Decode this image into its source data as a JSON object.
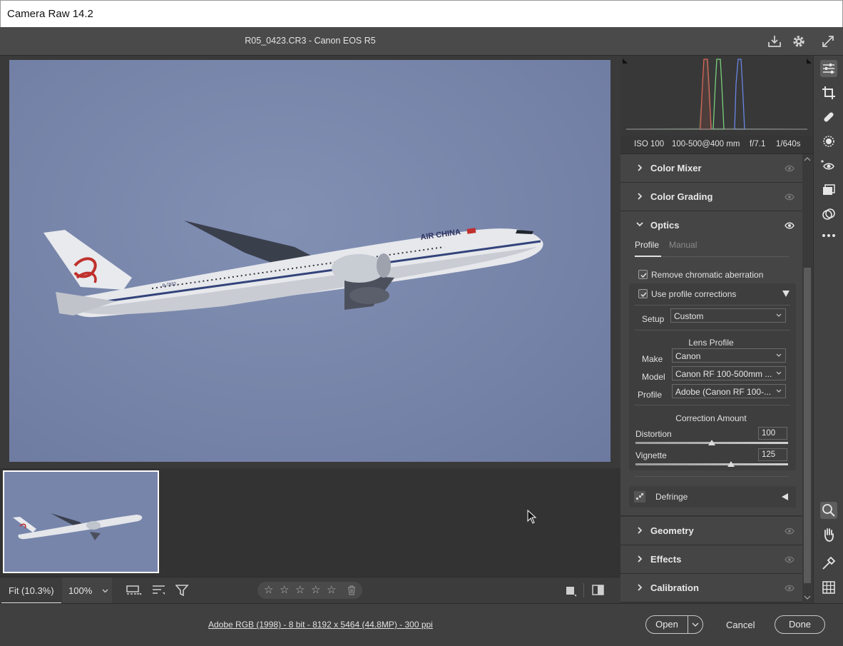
{
  "window": {
    "title": "Camera Raw 14.2"
  },
  "file": {
    "title": "R05_0423.CR3  -  Canon EOS R5"
  },
  "photo": {
    "airline_text": "AIR CHINA",
    "registration": "B-7832"
  },
  "exif": {
    "iso": "ISO 100",
    "lens": "100-500@400 mm",
    "aperture": "f/7.1",
    "shutter": "1/640s"
  },
  "panels": {
    "color_mixer": "Color Mixer",
    "color_grading": "Color Grading",
    "optics": "Optics",
    "geometry": "Geometry",
    "effects": "Effects",
    "calibration": "Calibration"
  },
  "optics": {
    "tabs": {
      "profile": "Profile",
      "manual": "Manual"
    },
    "remove_ca": {
      "label": "Remove chromatic aberration",
      "checked": true
    },
    "use_profile": {
      "label": "Use profile corrections",
      "checked": true
    },
    "setup": {
      "label": "Setup",
      "value": "Custom"
    },
    "lens_profile_heading": "Lens Profile",
    "make": {
      "label": "Make",
      "value": "Canon"
    },
    "model": {
      "label": "Model",
      "value": "Canon RF 100-500mm ..."
    },
    "profile": {
      "label": "Profile",
      "value": "Adobe (Canon RF 100-..."
    },
    "correction_heading": "Correction Amount",
    "distortion": {
      "label": "Distortion",
      "value": "100",
      "level": 0.5
    },
    "vignette": {
      "label": "Vignette",
      "value": "125",
      "level": 0.625
    },
    "defringe": "Defringe"
  },
  "bottombar": {
    "zoom_fit": "Fit (10.3%)",
    "zoom_pct": "100%",
    "rating_stars": 5
  },
  "status": {
    "color_profile": "Adobe RGB (1998) - 8 bit - 8192 x 5464 (44.8MP) - 300 ppi",
    "open": "Open",
    "cancel": "Cancel",
    "done": "Done"
  },
  "colors": {
    "sky": "#7683a8",
    "panel": "#454545",
    "accent": "#ffffff"
  }
}
